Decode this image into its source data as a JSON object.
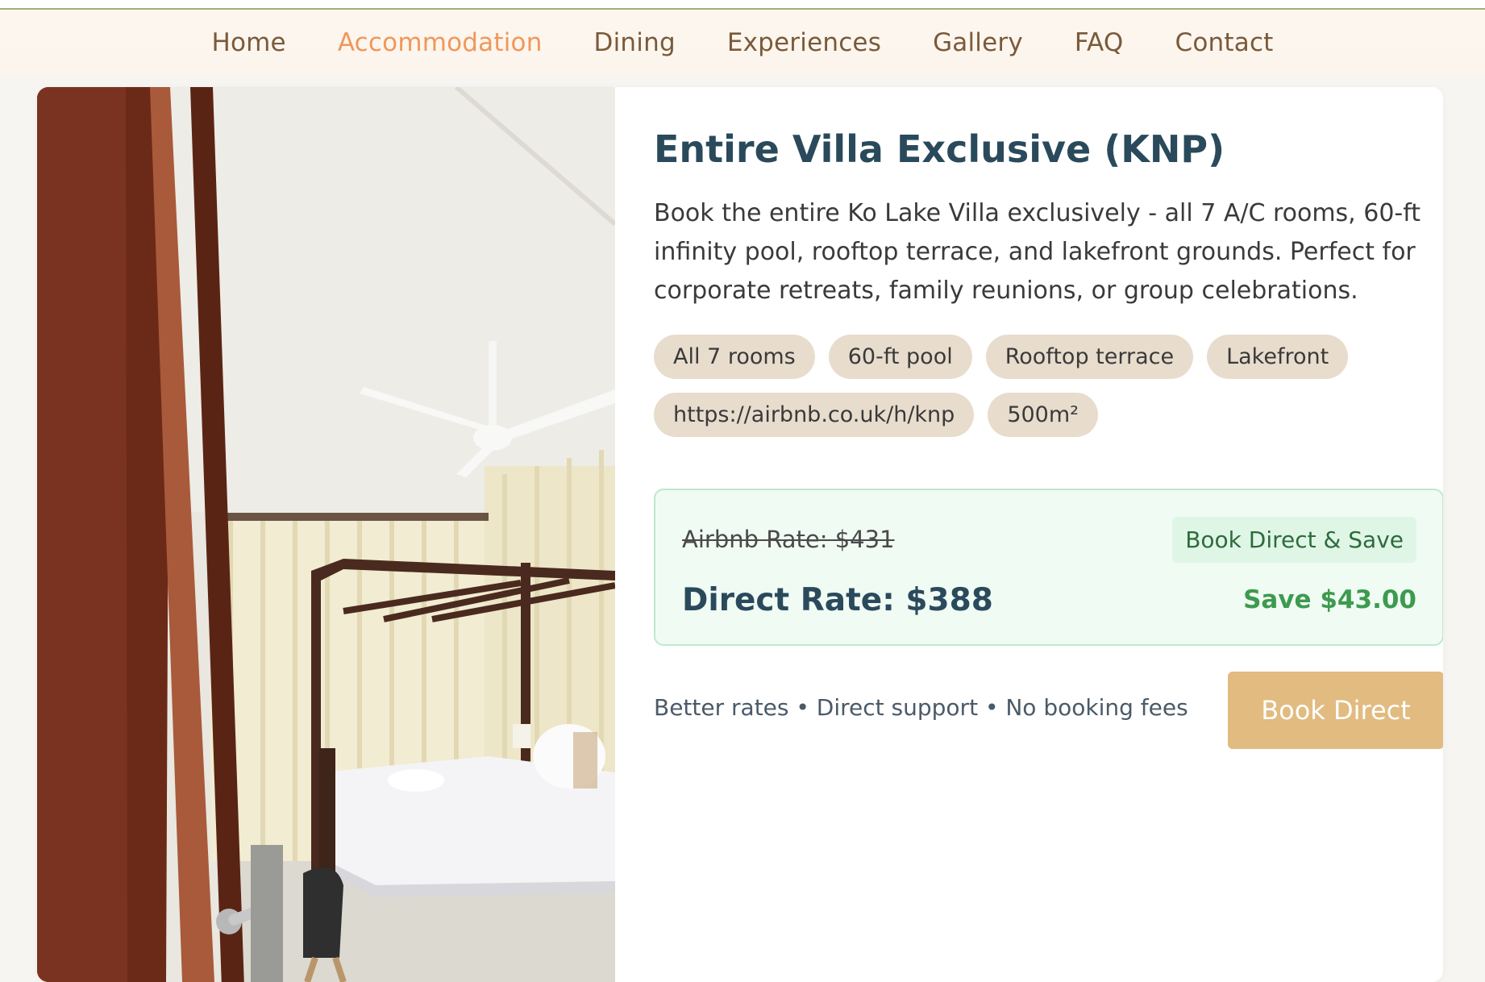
{
  "nav": {
    "items": [
      "Home",
      "Accommodation",
      "Dining",
      "Experiences",
      "Gallery",
      "FAQ",
      "Contact"
    ],
    "active": "Accommodation"
  },
  "listing": {
    "title": "Entire Villa Exclusive (KNP)",
    "description": "Book the entire Ko Lake Villa exclusively - all 7 A/C rooms, 60-ft infinity pool, rooftop terrace, and lakefront grounds. Perfect for corporate retreats, family reunions, or group celebrations.",
    "tags": [
      "All 7 rooms",
      "60-ft pool",
      "Rooftop terrace",
      "Lakefront",
      "https://airbnb.co.uk/h/knp",
      "500m²"
    ],
    "image": "bedroom-photo"
  },
  "pricing": {
    "airbnb_rate": "Airbnb Rate: $431",
    "badge": "Book Direct & Save",
    "direct_rate": "Direct Rate: $388",
    "savings": "Save $43.00"
  },
  "footer": {
    "perks": "Better rates • Direct support • No booking fees",
    "book_button": "Book Direct"
  },
  "colors": {
    "accent": "#f0975a",
    "brand_dark": "#2a4a5c",
    "button": "#e1bb80",
    "savings_green": "#3d9a4e"
  }
}
